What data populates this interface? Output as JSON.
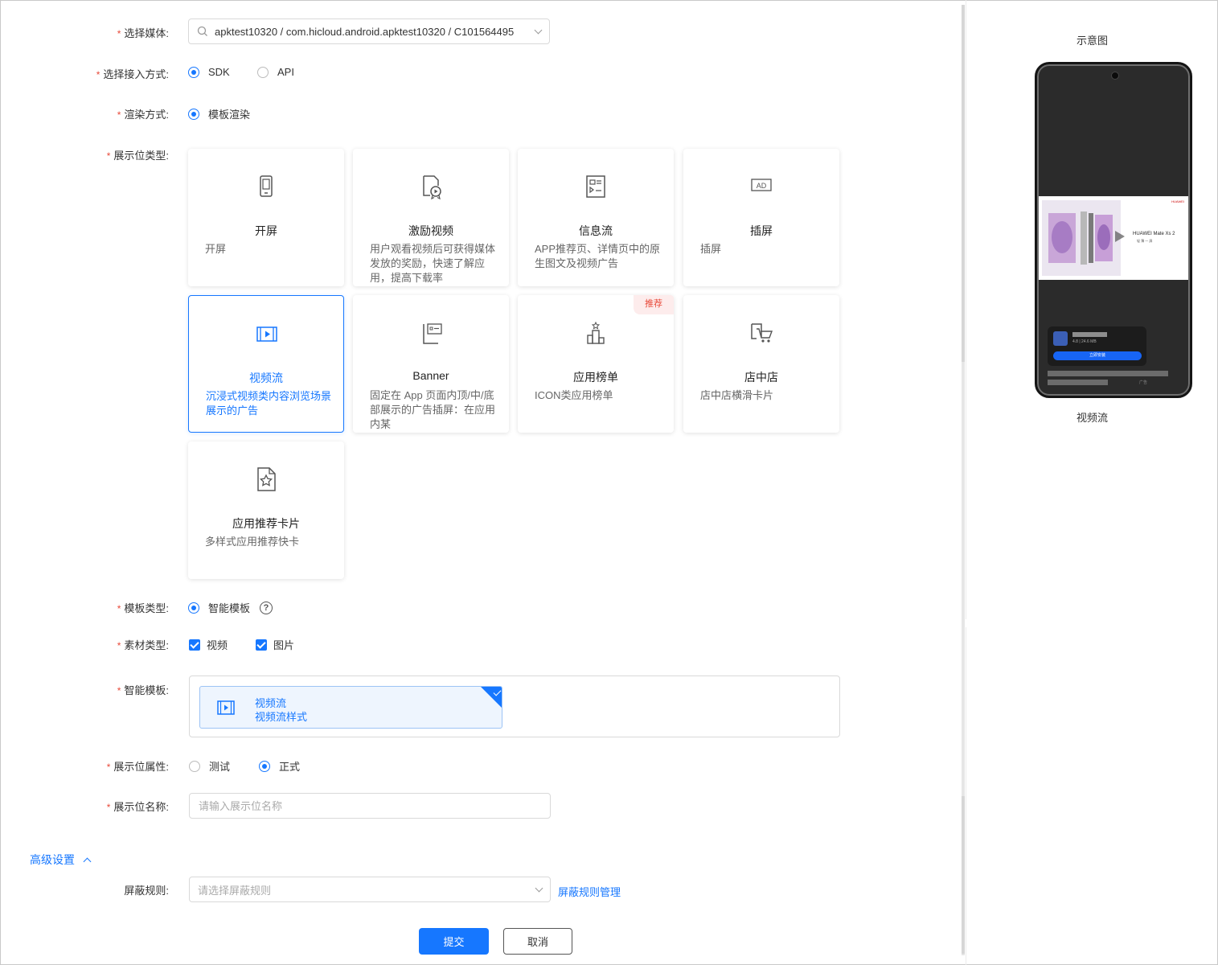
{
  "form": {
    "media": {
      "label": "选择媒体:",
      "value": "apktest10320 / com.hicloud.android.apktest10320 / C101564495"
    },
    "access": {
      "label": "选择接入方式:",
      "options": [
        "SDK",
        "API"
      ],
      "selected": "SDK"
    },
    "render": {
      "label": "渲染方式:",
      "options": [
        "模板渲染"
      ],
      "selected": "模板渲染"
    },
    "slot_type": {
      "label": "展示位类型:",
      "cards": [
        {
          "title": "开屏",
          "desc": "开屏",
          "icon": "phone-icon"
        },
        {
          "title": "激励视频",
          "desc": "用户观看视频后可获得媒体发放的奖励，快速了解应用，提高下载率",
          "icon": "reward-video-icon"
        },
        {
          "title": "信息流",
          "desc": "APP推荐页、详情页中的原生图文及视频广告",
          "icon": "feed-icon"
        },
        {
          "title": "插屏",
          "desc": "插屏",
          "icon": "ad-icon"
        },
        {
          "title": "视频流",
          "desc": "沉浸式视频类内容浏览场景展示的广告",
          "icon": "video-stream-icon",
          "selected": true
        },
        {
          "title": "Banner",
          "desc": "固定在 App 页面内顶/中/底部展示的广告插屏：在应用内某",
          "icon": "banner-icon"
        },
        {
          "title": "应用榜单",
          "desc": "ICON类应用榜单",
          "icon": "ranking-icon",
          "badge": "推荐"
        },
        {
          "title": "店中店",
          "desc": "店中店横滑卡片",
          "icon": "cart-icon"
        },
        {
          "title": "应用推荐卡片",
          "desc": "多样式应用推荐快卡",
          "icon": "star-doc-icon"
        }
      ]
    },
    "template_type": {
      "label": "模板类型:",
      "options": [
        "智能模板"
      ],
      "selected": "智能模板",
      "help": "?"
    },
    "material_type": {
      "label": "素材类型:",
      "options": [
        "视频",
        "图片"
      ],
      "checked": [
        "视频",
        "图片"
      ]
    },
    "smart_template": {
      "label": "智能模板:",
      "item_title": "视频流",
      "item_subtitle": "视频流样式"
    },
    "slot_property": {
      "label": "展示位属性:",
      "options": [
        "测试",
        "正式"
      ],
      "selected": "正式"
    },
    "slot_name": {
      "label": "展示位名称:",
      "placeholder": "请输入展示位名称",
      "value": ""
    },
    "advanced": {
      "label": "高级设置"
    },
    "block_rule": {
      "label": "屏蔽规则:",
      "placeholder": "请选择屏蔽规则",
      "manage_link": "屏蔽规则管理"
    },
    "actions": {
      "submit": "提交",
      "cancel": "取消"
    }
  },
  "preview": {
    "title": "示意图",
    "caption": "视频流",
    "ad_brand": "HUAWEI Mate Xs 2",
    "ad_slogan": "轻  薄  一  屏",
    "ad_logo": "HUAWEI",
    "app_meta": "4.8 | 24.6 MB",
    "app_button": "立即安装",
    "ad_tag": "广告"
  },
  "colors": {
    "accent": "#1677ff",
    "required": "#e84a3a",
    "badge_bg": "#fdecec"
  }
}
